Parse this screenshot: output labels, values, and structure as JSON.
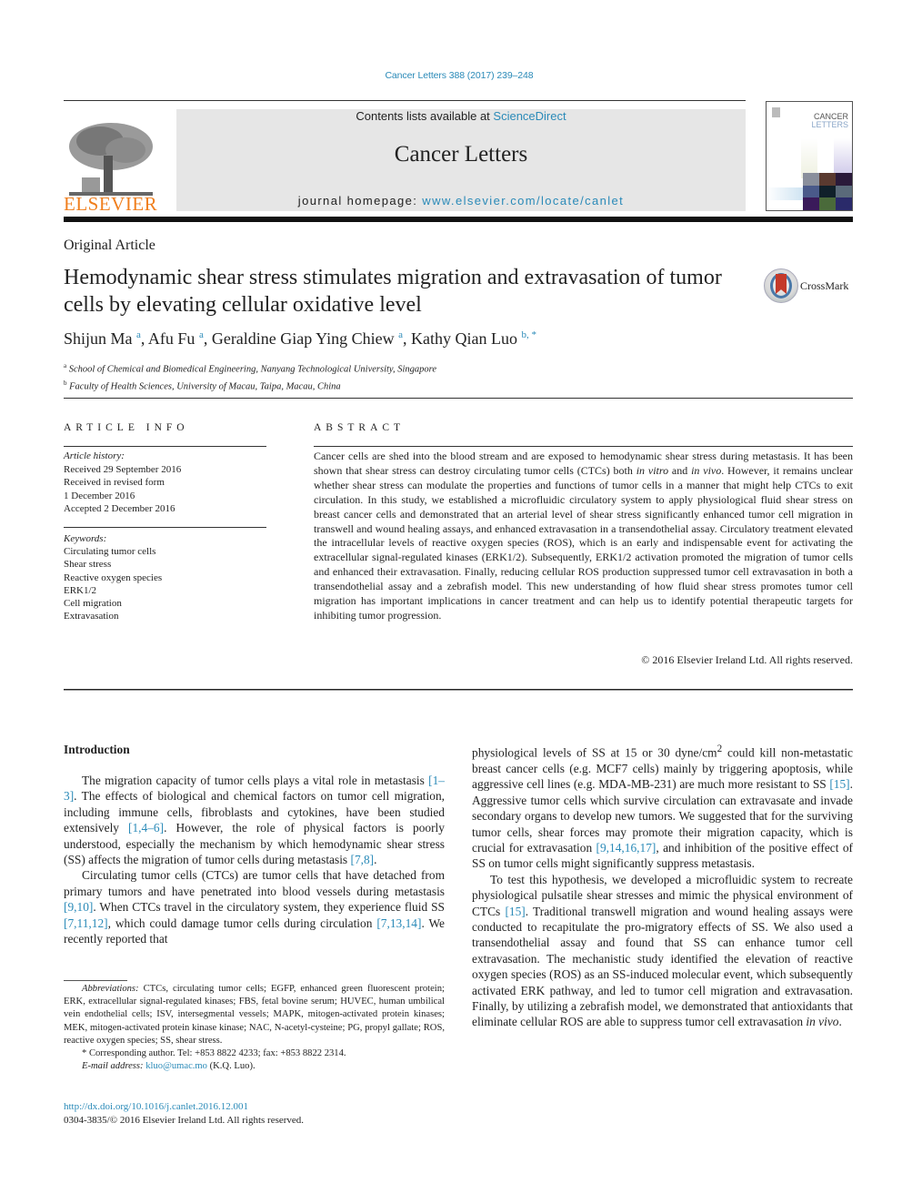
{
  "header": {
    "citation": "Cancer Letters 388 (2017) 239–248",
    "contents_prefix": "Contents lists available at ",
    "contents_link": "ScienceDirect",
    "journal_title": "Cancer Letters",
    "homepage_prefix": "journal homepage: ",
    "homepage_link": "www.elsevier.com/locate/canlet",
    "publisher_logo_text": "ELSEVIER",
    "cover_title_line1": "CANCER",
    "cover_title_line2": "LETTERS",
    "brand_color": "#f07f1e",
    "link_color": "#2a8ab8"
  },
  "article": {
    "type": "Original Article",
    "title": "Hemodynamic shear stress stimulates migration and extravasation of tumor cells by elevating cellular oxidative level",
    "crossmark_label": "CrossMark",
    "authors": [
      {
        "name": "Shijun Ma",
        "aff": "a"
      },
      {
        "name": "Afu Fu",
        "aff": "a"
      },
      {
        "name": "Geraldine Giap Ying Chiew",
        "aff": "a"
      },
      {
        "name": "Kathy Qian Luo",
        "aff": "b, *"
      }
    ],
    "affiliations": [
      {
        "key": "a",
        "text": "School of Chemical and Biomedical Engineering, Nanyang Technological University, Singapore"
      },
      {
        "key": "b",
        "text": "Faculty of Health Sciences, University of Macau, Taipa, Macau, China"
      }
    ]
  },
  "article_info": {
    "heading": "ARTICLE INFO",
    "history_label": "Article history:",
    "history": [
      "Received 29 September 2016",
      "Received in revised form",
      "1 December 2016",
      "Accepted 2 December 2016"
    ],
    "keywords_label": "Keywords:",
    "keywords": [
      "Circulating tumor cells",
      "Shear stress",
      "Reactive oxygen species",
      "ERK1/2",
      "Cell migration",
      "Extravasation"
    ]
  },
  "abstract": {
    "heading": "ABSTRACT",
    "text_1": "Cancer cells are shed into the blood stream and are exposed to hemodynamic shear stress during metastasis. It has been shown that shear stress can destroy circulating tumor cells (CTCs) both ",
    "text_italic_1": "in vitro",
    "text_2": " and ",
    "text_italic_2": "in vivo",
    "text_3": ". However, it remains unclear whether shear stress can modulate the properties and functions of tumor cells in a manner that might help CTCs to exit circulation. In this study, we established a microfluidic circulatory system to apply physiological fluid shear stress on breast cancer cells and demonstrated that an arterial level of shear stress significantly enhanced tumor cell migration in transwell and wound healing assays, and enhanced extravasation in a transendothelial assay. Circulatory treatment elevated the intracellular levels of reactive oxygen species (ROS), which is an early and indispensable event for activating the extracellular signal-regulated kinases (ERK1/2). Subsequently, ERK1/2 activation promoted the migration of tumor cells and enhanced their extravasation. Finally, reducing cellular ROS production suppressed tumor cell extravasation in both a transendothelial assay and a zebrafish model. This new understanding of how fluid shear stress promotes tumor cell migration has important implications in cancer treatment and can help us to identify potential therapeutic targets for inhibiting tumor progression.",
    "copyright": "© 2016 Elsevier Ireland Ltd. All rights reserved."
  },
  "body": {
    "section_heading": "Introduction",
    "left": {
      "p1_a": "The migration capacity of tumor cells plays a vital role in metastasis ",
      "p1_ref1": "[1–3]",
      "p1_b": ". The effects of biological and chemical factors on tumor cell migration, including immune cells, fibroblasts and cytokines, have been studied extensively ",
      "p1_ref2": "[1,4–6]",
      "p1_c": ". However, the role of physical factors is poorly understood, especially the mechanism by which hemodynamic shear stress (SS) affects the migration of tumor cells during metastasis ",
      "p1_ref3": "[7,8]",
      "p1_d": ".",
      "p2_a": "Circulating tumor cells (CTCs) are tumor cells that have detached from primary tumors and have penetrated into blood vessels during metastasis ",
      "p2_ref1": "[9,10]",
      "p2_b": ". When CTCs travel in the circulatory system, they experience fluid SS ",
      "p2_ref2": "[7,11,12]",
      "p2_c": ", which could damage tumor cells during circulation ",
      "p2_ref3": "[7,13,14]",
      "p2_d": ". We recently reported that"
    },
    "right": {
      "p1_a": "physiological levels of SS at 15 or 30 dyne/cm",
      "p1_sup": "2",
      "p1_b": " could kill non-metastatic breast cancer cells (e.g. MCF7 cells) mainly by triggering apoptosis, while aggressive cell lines (e.g. MDA-MB-231) are much more resistant to SS ",
      "p1_ref1": "[15]",
      "p1_c": ". Aggressive tumor cells which survive circulation can extravasate and invade secondary organs to develop new tumors. We suggested that for the surviving tumor cells, shear forces may promote their migration capacity, which is crucial for extravasation ",
      "p1_ref2": "[9,14,16,17]",
      "p1_d": ", and inhibition of the positive effect of SS on tumor cells might significantly suppress metastasis.",
      "p2_a": "To test this hypothesis, we developed a microfluidic system to recreate physiological pulsatile shear stresses and mimic the physical environment of CTCs ",
      "p2_ref1": "[15]",
      "p2_b": ". Traditional transwell migration and wound healing assays were conducted to recapitulate the pro-migratory effects of SS. We also used a transendothelial assay and found that SS can enhance tumor cell extravasation. The mechanistic study identified the elevation of reactive oxygen species (ROS) as an SS-induced molecular event, which subsequently activated ERK pathway, and led to tumor cell migration and extravasation. Finally, by utilizing a zebrafish model, we demonstrated that antioxidants that eliminate cellular ROS are able to suppress tumor cell extravasation ",
      "p2_italic": "in vivo",
      "p2_c": "."
    }
  },
  "footnotes": {
    "abbrev_label": "Abbreviations:",
    "abbrev_text": " CTCs, circulating tumor cells; EGFP, enhanced green fluorescent protein; ERK, extracellular signal-regulated kinases; FBS, fetal bovine serum; HUVEC, human umbilical vein endothelial cells; ISV, intersegmental vessels; MAPK, mitogen-activated protein kinases; MEK, mitogen-activated protein kinase kinase; NAC, N-acetyl-cysteine; PG, propyl gallate; ROS, reactive oxygen species; SS, shear stress.",
    "corresponding": "* Corresponding author. Tel: +853 8822 4233; fax: +853 8822 2314.",
    "email_label": "E-mail address:",
    "email": "kluo@umac.mo",
    "email_suffix": " (K.Q. Luo).",
    "doi": "http://dx.doi.org/10.1016/j.canlet.2016.12.001",
    "issn": "0304-3835/© 2016 Elsevier Ireland Ltd. All rights reserved."
  }
}
